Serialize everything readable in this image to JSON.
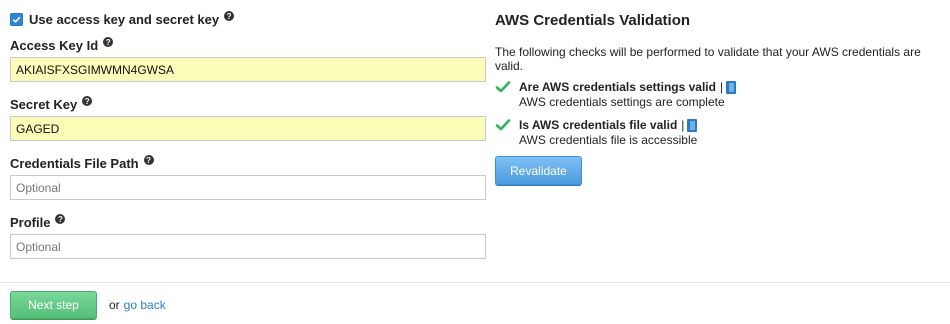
{
  "form": {
    "use_keys_label": "Use access key and secret key",
    "use_keys_checked": true,
    "access_key": {
      "label": "Access Key Id",
      "value": "AKIAISFXSGIMWMN4GWSA"
    },
    "secret_key": {
      "label": "Secret Key",
      "value": "GAGED"
    },
    "credentials_file": {
      "label": "Credentials File Path",
      "placeholder": "Optional",
      "value": ""
    },
    "profile": {
      "label": "Profile",
      "placeholder": "Optional",
      "value": ""
    }
  },
  "validation": {
    "title": "AWS Credentials Validation",
    "description": "The following checks will be performed to validate that your AWS credentials are valid.",
    "checks": [
      {
        "title": "Are AWS credentials settings valid",
        "separator": "|",
        "status": "ok",
        "message": "AWS credentials settings are complete"
      },
      {
        "title": "Is AWS credentials file valid",
        "separator": "|",
        "status": "ok",
        "message": "AWS credentials file is accessible"
      }
    ],
    "revalidate_label": "Revalidate"
  },
  "footer": {
    "next_label": "Next step",
    "or_text": "or",
    "back_label": "go back"
  },
  "colors": {
    "primary": "#4a9be0",
    "success": "#56c07a",
    "check": "#2fb35a",
    "filled_input": "#fafcb8"
  }
}
